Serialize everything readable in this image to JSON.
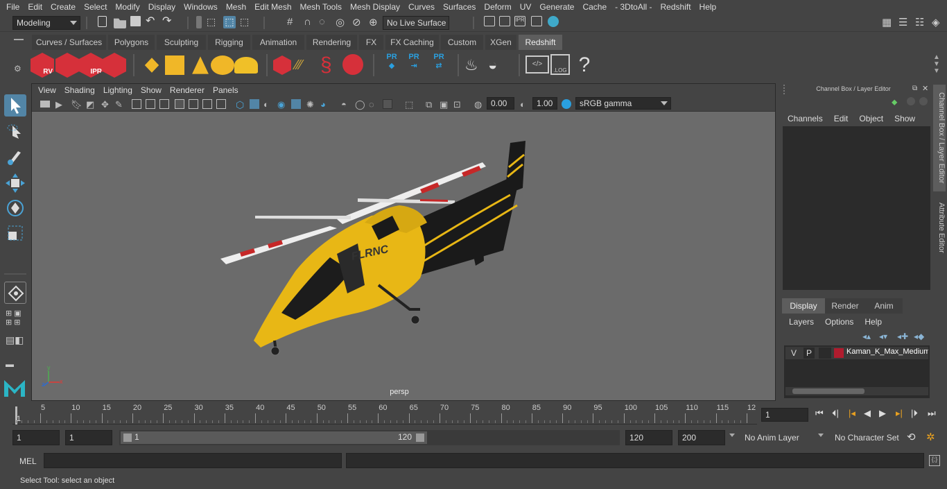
{
  "menubar": [
    "File",
    "Edit",
    "Create",
    "Select",
    "Modify",
    "Display",
    "Windows",
    "Mesh",
    "Edit Mesh",
    "Mesh Tools",
    "Mesh Display",
    "Curves",
    "Surfaces",
    "Deform",
    "UV",
    "Generate",
    "Cache",
    "- 3DtoAll -",
    "Redshift",
    "Help"
  ],
  "status": {
    "workspace": "Modeling",
    "live_surface": "No Live Surface"
  },
  "shelf_tabs": [
    "Curves / Surfaces",
    "Polygons",
    "Sculpting",
    "Rigging",
    "Animation",
    "Rendering",
    "FX",
    "FX Caching",
    "Custom",
    "XGen",
    "Redshift"
  ],
  "shelf_icon_labels": {
    "rv": "RV",
    "ipr": "IPR",
    "pr1": "PR",
    "pr2": "PR",
    "pr3": "PR",
    "log": ".LOG",
    "help": "?"
  },
  "viewport": {
    "menus": [
      "View",
      "Shading",
      "Lighting",
      "Show",
      "Renderer",
      "Panels"
    ],
    "exposure": "0.00",
    "gamma": "1.00",
    "color_space": "sRGB gamma",
    "camera_label": "persp",
    "model_text": "FLRNC"
  },
  "axis": {
    "y": "y",
    "x": "x",
    "z": "z"
  },
  "channel_box": {
    "title": "Channel Box / Layer Editor",
    "menus": [
      "Channels",
      "Edit",
      "Object",
      "Show"
    ],
    "layer_tabs": [
      "Display",
      "Render",
      "Anim"
    ],
    "layer_menus": [
      "Layers",
      "Options",
      "Help"
    ],
    "layer": {
      "v": "V",
      "p": "P",
      "name": "Kaman_K_Max_Medium"
    }
  },
  "side_tabs": [
    "Channel Box / Layer Editor",
    "Attribute Editor"
  ],
  "timeline": {
    "ticks": [
      "5",
      "10",
      "15",
      "20",
      "25",
      "30",
      "35",
      "40",
      "45",
      "50",
      "55",
      "60",
      "65",
      "70",
      "75",
      "80",
      "85",
      "90",
      "95",
      "100",
      "105",
      "110",
      "115",
      "12"
    ],
    "start": "1",
    "current": "1"
  },
  "range": {
    "start": "1",
    "playback_start": "1",
    "slider_start": "1",
    "slider_end": "120",
    "end": "120",
    "anim_end": "200",
    "anim_layer": "No Anim Layer",
    "char_set": "No Character Set"
  },
  "cmd": {
    "label": "MEL"
  },
  "help_line": "Select Tool: select an object",
  "colors": {
    "bg": "#444444",
    "viewport": "#6b6b6b",
    "accent": "#5285a6",
    "redshift_red": "#d6303a",
    "pr_blue": "#2aa0e0",
    "layer_red": "#b01c2e",
    "heli_yellow": "#e8b715"
  }
}
